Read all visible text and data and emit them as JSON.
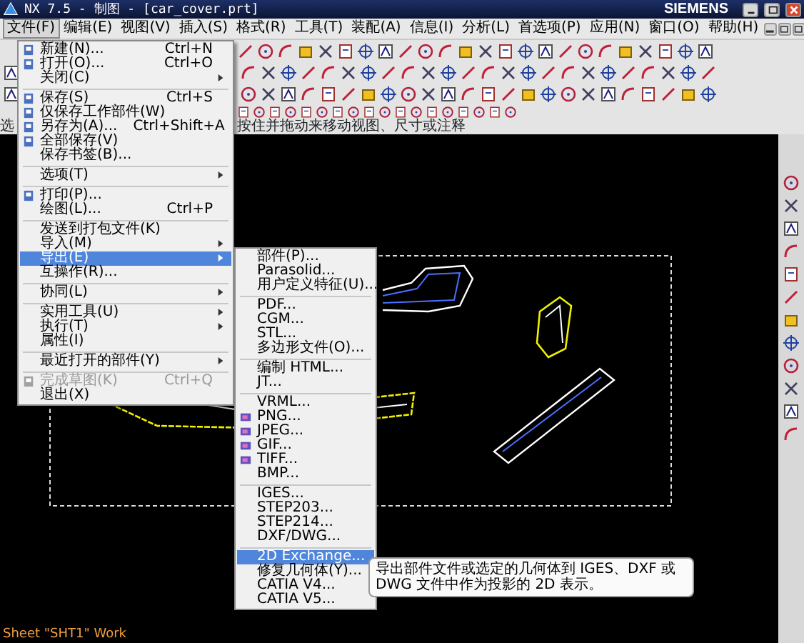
{
  "window": {
    "title": "NX 7.5 - 制图 - [car_cover.prt]",
    "brand": "SIEMENS"
  },
  "menu_bar": [
    {
      "label": "文件(F)",
      "selected": true
    },
    {
      "label": "编辑(E)",
      "selected": false
    },
    {
      "label": "视图(V)",
      "selected": false
    },
    {
      "label": "插入(S)",
      "selected": false
    },
    {
      "label": "格式(R)",
      "selected": false
    },
    {
      "label": "工具(T)",
      "selected": false
    },
    {
      "label": "装配(A)",
      "selected": false
    },
    {
      "label": "信息(I)",
      "selected": false
    },
    {
      "label": "分析(L)",
      "selected": false
    },
    {
      "label": "首选项(P)",
      "selected": false
    },
    {
      "label": "应用(N)",
      "selected": false
    },
    {
      "label": "窗口(O)",
      "selected": false
    },
    {
      "label": "帮助(H)",
      "selected": false
    }
  ],
  "prompt_left": "选",
  "prompt_right": "按住并拖动来移动视图、尺寸或注释",
  "file_menu": [
    {
      "kind": "item",
      "label": "新建(N)...",
      "shortcut": "Ctrl+N",
      "icon": true,
      "submenu": false,
      "disabled": false,
      "selected": false
    },
    {
      "kind": "item",
      "label": "打开(O)...",
      "shortcut": "Ctrl+O",
      "icon": true,
      "submenu": false,
      "disabled": false,
      "selected": false
    },
    {
      "kind": "item",
      "label": "关闭(C)",
      "icon": false,
      "submenu": true,
      "disabled": false,
      "selected": false
    },
    {
      "kind": "separator"
    },
    {
      "kind": "item",
      "label": "保存(S)",
      "shortcut": "Ctrl+S",
      "icon": true,
      "submenu": false,
      "disabled": false,
      "selected": false
    },
    {
      "kind": "item",
      "label": "仅保存工作部件(W)",
      "icon": true,
      "submenu": false,
      "disabled": false,
      "selected": false
    },
    {
      "kind": "item",
      "label": "另存为(A)...",
      "shortcut": "Ctrl+Shift+A",
      "icon": true,
      "submenu": false,
      "disabled": false,
      "selected": false
    },
    {
      "kind": "item",
      "label": "全部保存(V)",
      "icon": true,
      "submenu": false,
      "disabled": false,
      "selected": false
    },
    {
      "kind": "item",
      "label": "保存书签(B)...",
      "icon": false,
      "submenu": false,
      "disabled": false,
      "selected": false
    },
    {
      "kind": "separator"
    },
    {
      "kind": "item",
      "label": "选项(T)",
      "icon": false,
      "submenu": true,
      "disabled": false,
      "selected": false
    },
    {
      "kind": "separator"
    },
    {
      "kind": "item",
      "label": "打印(P)...",
      "icon": true,
      "submenu": false,
      "disabled": false,
      "selected": false
    },
    {
      "kind": "item",
      "label": "绘图(L)...",
      "shortcut": "Ctrl+P",
      "icon": false,
      "submenu": false,
      "disabled": false,
      "selected": false
    },
    {
      "kind": "separator"
    },
    {
      "kind": "item",
      "label": "发送到打包文件(K)",
      "icon": false,
      "submenu": false,
      "disabled": false,
      "selected": false
    },
    {
      "kind": "item",
      "label": "导入(M)",
      "icon": false,
      "submenu": true,
      "disabled": false,
      "selected": false
    },
    {
      "kind": "item",
      "label": "导出(E)",
      "icon": false,
      "submenu": true,
      "disabled": false,
      "selected": true
    },
    {
      "kind": "item",
      "label": "互操作(R)...",
      "icon": false,
      "submenu": false,
      "disabled": false,
      "selected": false
    },
    {
      "kind": "separator"
    },
    {
      "kind": "item",
      "label": "协同(L)",
      "icon": false,
      "submenu": true,
      "disabled": false,
      "selected": false
    },
    {
      "kind": "separator"
    },
    {
      "kind": "item",
      "label": "实用工具(U)",
      "icon": false,
      "submenu": true,
      "disabled": false,
      "selected": false
    },
    {
      "kind": "item",
      "label": "执行(T)",
      "icon": false,
      "submenu": true,
      "disabled": false,
      "selected": false
    },
    {
      "kind": "item",
      "label": "属性(I)",
      "icon": false,
      "submenu": false,
      "disabled": false,
      "selected": false
    },
    {
      "kind": "separator"
    },
    {
      "kind": "item",
      "label": "最近打开的部件(Y)",
      "icon": false,
      "submenu": true,
      "disabled": false,
      "selected": false
    },
    {
      "kind": "separator"
    },
    {
      "kind": "item",
      "label": "完成草图(K)",
      "shortcut": "Ctrl+Q",
      "icon": true,
      "submenu": false,
      "disabled": true,
      "selected": false
    },
    {
      "kind": "item",
      "label": "退出(X)",
      "icon": false,
      "submenu": false,
      "disabled": false,
      "selected": false
    }
  ],
  "export_menu": [
    {
      "kind": "item",
      "label": "部件(P)...",
      "icon": false,
      "selected": false
    },
    {
      "kind": "item",
      "label": "Parasolid...",
      "icon": false,
      "selected": false
    },
    {
      "kind": "item",
      "label": "用户定义特征(U)...",
      "icon": false,
      "selected": false
    },
    {
      "kind": "separator"
    },
    {
      "kind": "item",
      "label": "PDF...",
      "icon": false,
      "selected": false
    },
    {
      "kind": "item",
      "label": "CGM...",
      "icon": false,
      "selected": false
    },
    {
      "kind": "item",
      "label": "STL...",
      "icon": false,
      "selected": false
    },
    {
      "kind": "item",
      "label": "多边形文件(O)...",
      "icon": false,
      "selected": false
    },
    {
      "kind": "separator"
    },
    {
      "kind": "item",
      "label": "编制 HTML...",
      "icon": false,
      "selected": false
    },
    {
      "kind": "item",
      "label": "JT...",
      "icon": false,
      "selected": false
    },
    {
      "kind": "separator"
    },
    {
      "kind": "item",
      "label": "VRML...",
      "icon": false,
      "selected": false
    },
    {
      "kind": "item",
      "label": "PNG...",
      "icon": true,
      "selected": false
    },
    {
      "kind": "item",
      "label": "JPEG...",
      "icon": true,
      "selected": false
    },
    {
      "kind": "item",
      "label": "GIF...",
      "icon": true,
      "selected": false
    },
    {
      "kind": "item",
      "label": "TIFF...",
      "icon": true,
      "selected": false
    },
    {
      "kind": "item",
      "label": "BMP...",
      "icon": false,
      "selected": false
    },
    {
      "kind": "separator"
    },
    {
      "kind": "item",
      "label": "IGES...",
      "icon": false,
      "selected": false
    },
    {
      "kind": "item",
      "label": "STEP203...",
      "icon": false,
      "selected": false
    },
    {
      "kind": "item",
      "label": "STEP214...",
      "icon": false,
      "selected": false
    },
    {
      "kind": "item",
      "label": "DXF/DWG...",
      "icon": false,
      "selected": false
    },
    {
      "kind": "separator"
    },
    {
      "kind": "item",
      "label": "2D Exchange...",
      "icon": false,
      "selected": true
    },
    {
      "kind": "item",
      "label": "修复几何体(Y)...",
      "icon": false,
      "selected": false
    },
    {
      "kind": "item",
      "label": "CATIA V4...",
      "icon": false,
      "selected": false
    },
    {
      "kind": "item",
      "label": "CATIA V5...",
      "icon": false,
      "selected": false
    }
  ],
  "tooltip": "导出部件文件或选定的几何体到 IGES、DXF 或 DWG 文件中作为投影的 2D 表示。",
  "status": "Sheet \"SHT1\" Work"
}
